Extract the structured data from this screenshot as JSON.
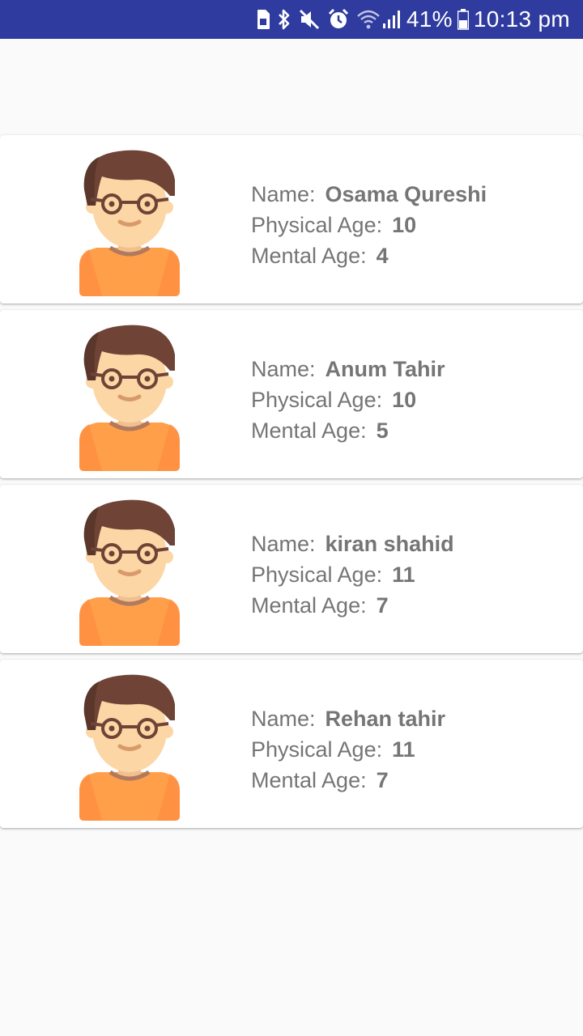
{
  "status_bar": {
    "battery_percent": "41%",
    "time": "10:13 pm",
    "icons": [
      "sim-icon",
      "bluetooth-icon",
      "mute-icon",
      "alarm-icon",
      "wifi-icon",
      "signal-icon",
      "battery-icon"
    ]
  },
  "colors": {
    "status_bar_bg": "#2f3b9e",
    "background": "#fafafa",
    "card_bg": "#ffffff",
    "text": "#757575",
    "shirt": "#ff9f4a",
    "hair": "#6f4436",
    "skin": "#fcd6a5"
  },
  "labels": {
    "name": "Name:",
    "physical_age": "Physical Age:",
    "mental_age": "Mental Age:"
  },
  "people": [
    {
      "name": "Osama Qureshi",
      "physical_age": "10",
      "mental_age": "4"
    },
    {
      "name": "Anum Tahir",
      "physical_age": "10",
      "mental_age": "5"
    },
    {
      "name": "kiran shahid",
      "physical_age": "11",
      "mental_age": "7"
    },
    {
      "name": "Rehan tahir",
      "physical_age": "11",
      "mental_age": "7"
    }
  ]
}
